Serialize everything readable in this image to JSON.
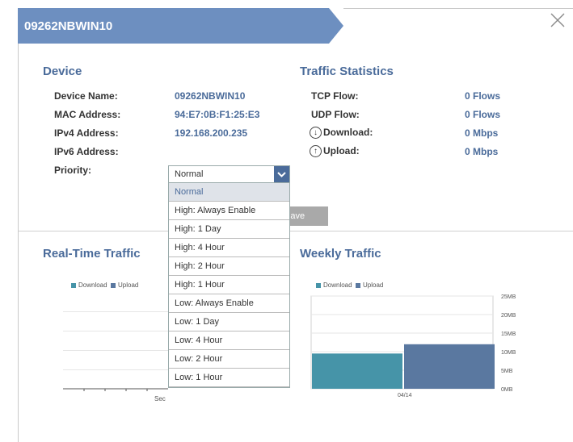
{
  "dialog": {
    "title": "09262NBWIN10"
  },
  "device": {
    "heading": "Device",
    "rows": [
      {
        "label": "Device Name:",
        "value": "09262NBWIN10"
      },
      {
        "label": "MAC Address:",
        "value": "94:E7:0B:F1:25:E3"
      },
      {
        "label": "IPv4 Address:",
        "value": "192.168.200.235"
      },
      {
        "label": "IPv6 Address:",
        "value": ""
      }
    ],
    "priority_label": "Priority:",
    "priority_selected": "Normal",
    "priority_options": [
      "Normal",
      "High: Always Enable",
      "High: 1 Day",
      "High: 4 Hour",
      "High: 2 Hour",
      "High: 1 Hour",
      "Low: Always Enable",
      "Low: 1 Day",
      "Low: 4 Hour",
      "Low: 2 Hour",
      "Low: 1 Hour"
    ],
    "save_label": "Save"
  },
  "traffic": {
    "heading": "Traffic Statistics",
    "rows": [
      {
        "label": "TCP Flow:",
        "value": "0 Flows"
      },
      {
        "label": "UDP Flow:",
        "value": "0 Flows"
      },
      {
        "label": "Download:",
        "value": "0 Mbps"
      },
      {
        "label": "Upload:",
        "value": "0 Mbps"
      }
    ]
  },
  "realtime": {
    "heading": "Real-Time Traffic",
    "legend": [
      "Download",
      "Upload"
    ],
    "x_label": "Sec"
  },
  "weekly": {
    "heading": "Weekly Traffic",
    "legend": [
      "Download",
      "Upload"
    ],
    "y_ticks": [
      "25MB",
      "20MB",
      "15MB",
      "10MB",
      "5MB",
      "0MB"
    ],
    "x_label": "04/14"
  },
  "colors": {
    "accent": "#4a6b9a",
    "banner": "#6d8fc0",
    "download": "#4694a8",
    "upload": "#5a78a0"
  },
  "chart_data": {
    "type": "bar",
    "categories": [
      "04/14"
    ],
    "series": [
      {
        "name": "Download",
        "values": [
          9.5
        ]
      },
      {
        "name": "Upload",
        "values": [
          12
        ]
      }
    ],
    "ylabel": "",
    "ylim": [
      0,
      25
    ]
  }
}
